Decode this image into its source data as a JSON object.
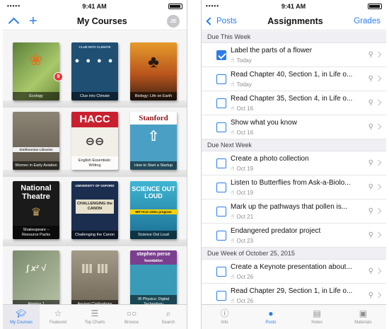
{
  "left": {
    "status": {
      "signal": "•••••",
      "time": "9:41 AM"
    },
    "nav": {
      "title": "My Courses",
      "avatar": "JE"
    },
    "books": [
      {
        "caption": "Ecology",
        "badge": "9"
      },
      {
        "caption": "Clue into Climate",
        "art_text": "CLUE INTO CLIMATE"
      },
      {
        "caption": "Biology: Life on Earth"
      },
      {
        "caption": "Women in Early Aviation",
        "art_text": "Smithsonian Libraries"
      },
      {
        "caption": "English Essentials: Writing",
        "art_text": "HACC"
      },
      {
        "caption": "How to Start a Startup",
        "art_text": "Stanford"
      },
      {
        "caption": "Shakespeare – Resource Packs",
        "art_text": "National Theatre"
      },
      {
        "caption": "Challenging the Canon",
        "art_text": "UNIVERSITY OF OXFORD",
        "art_text2": "CHALLENGING the CANON"
      },
      {
        "caption": "Science Out Loud",
        "art_text": "SCIENCE OUT LOUD",
        "art_text2": "MIT+K12 video program"
      },
      {
        "caption": "Algebra 1"
      },
      {
        "caption": "Ancient Civilizations"
      },
      {
        "caption": "IB Physics: Digital Technology",
        "art_text": "stephen perse",
        "art_text2": "foundation"
      }
    ],
    "tabs": [
      {
        "label": "My Courses",
        "icon": "graduation-cap-icon"
      },
      {
        "label": "Featured",
        "icon": "star-icon"
      },
      {
        "label": "Top Charts",
        "icon": "list-icon"
      },
      {
        "label": "Browse",
        "icon": "glasses-icon"
      },
      {
        "label": "Search",
        "icon": "search-icon"
      }
    ]
  },
  "right": {
    "status": {
      "signal": "•••••",
      "time": "9:41 AM"
    },
    "nav": {
      "back": "Posts",
      "title": "Assignments",
      "action": "Grades"
    },
    "sections": [
      {
        "header": "Due This Week",
        "items": [
          {
            "title": "Label the parts of a flower",
            "due": "Today",
            "checked": true
          },
          {
            "title": "Read Chapter 40, Section 1, in Life o...",
            "due": "Today",
            "checked": false
          },
          {
            "title": "Read Chapter 35, Section 4, in Life o...",
            "due": "Oct 16",
            "checked": false
          },
          {
            "title": "Show what you know",
            "due": "Oct 16",
            "checked": false
          }
        ]
      },
      {
        "header": "Due Next Week",
        "items": [
          {
            "title": "Create a photo collection",
            "due": "Oct 19",
            "checked": false
          },
          {
            "title": "Listen to Butterflies from Ask-a-Biolo...",
            "due": "Oct 19",
            "checked": false
          },
          {
            "title": "Mark up the pathways that pollen is...",
            "due": "Oct 21",
            "checked": false
          },
          {
            "title": "Endangered predator project",
            "due": "Oct 23",
            "checked": false
          }
        ]
      },
      {
        "header": "Due Week of October 25, 2015",
        "items": [
          {
            "title": "Create a Keynote presentation about...",
            "due": "Oct 26",
            "checked": false
          },
          {
            "title": "Read Chapter 29, Section 1, in Life o...",
            "due": "Oct 26",
            "checked": false
          }
        ]
      }
    ],
    "tabs": [
      {
        "label": "Info",
        "icon": "info-icon"
      },
      {
        "label": "Posts",
        "icon": "speech-bubble-icon"
      },
      {
        "label": "Notes",
        "icon": "notes-icon"
      },
      {
        "label": "Materials",
        "icon": "materials-icon"
      }
    ]
  },
  "colors": {
    "accent": "#2b7de9",
    "badge": "#e53935"
  }
}
